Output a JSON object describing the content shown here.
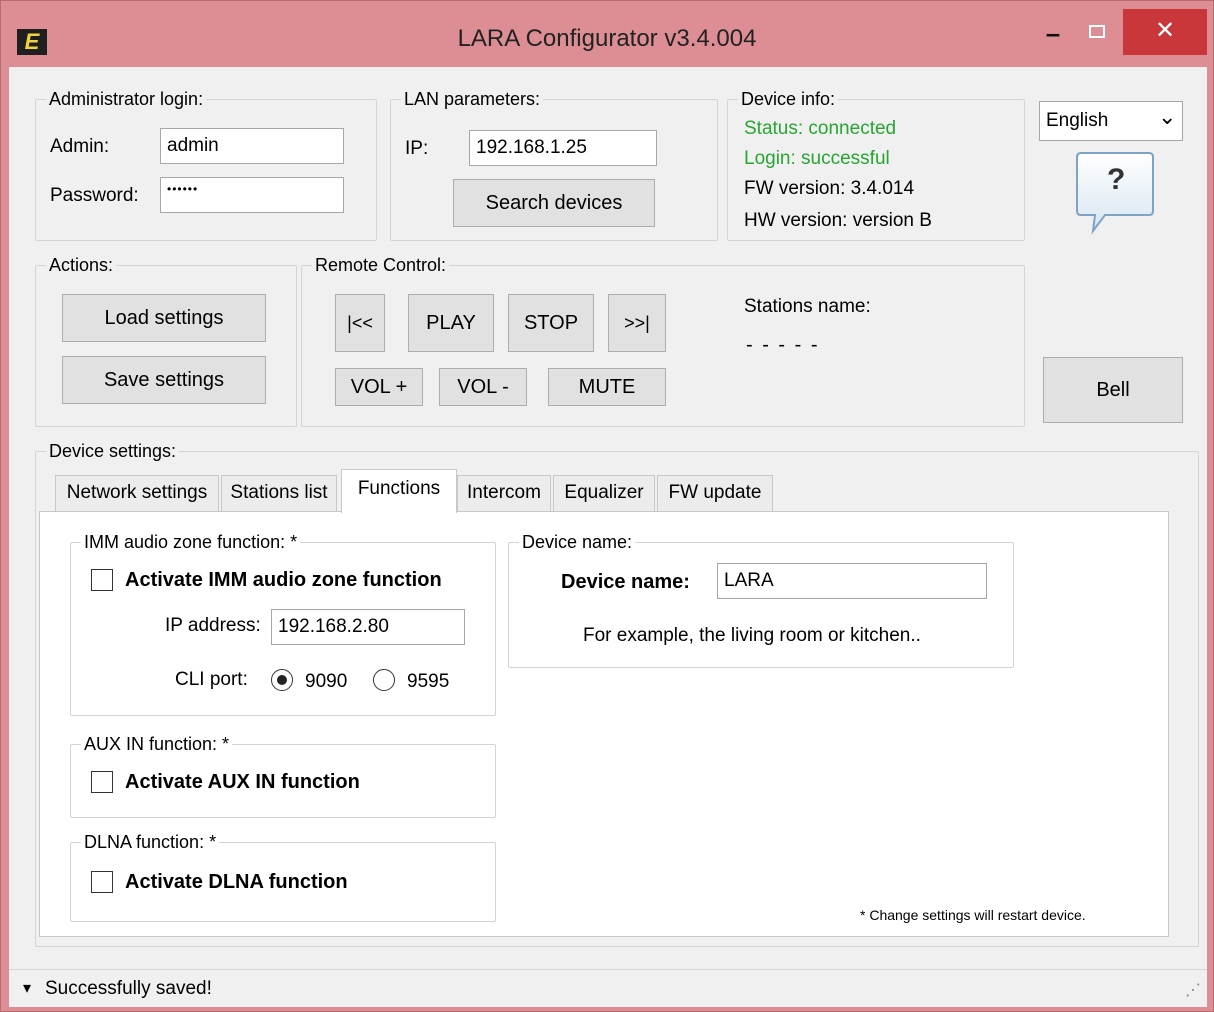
{
  "window": {
    "title": "LARA Configurator v3.4.004",
    "app_icon": "E",
    "minimize_glyph": "–",
    "close_glyph": "✕"
  },
  "admin_login": {
    "group_label": "Administrator login:",
    "admin_label": "Admin:",
    "admin_value": "admin",
    "password_label": "Password:",
    "password_value": "••••••"
  },
  "lan": {
    "group_label": "LAN parameters:",
    "ip_label": "IP:",
    "ip_value": "192.168.1.25",
    "search_button": "Search devices"
  },
  "device_info": {
    "group_label": "Device info:",
    "status": "Status: connected",
    "login": "Login: successful",
    "fw_version": "FW version: 3.4.014",
    "hw_version": "HW version: version B",
    "status_color": "#26a631"
  },
  "language": {
    "selected": "English",
    "chevron_glyph": "⌄"
  },
  "help": {
    "glyph": "?"
  },
  "actions": {
    "group_label": "Actions:",
    "load_button": "Load settings",
    "save_button": "Save settings"
  },
  "remote_control": {
    "group_label": "Remote Control:",
    "prev_button": "|<<",
    "play_button": "PLAY",
    "stop_button": "STOP",
    "next_button": ">>|",
    "vol_up_button": "VOL +",
    "vol_down_button": "VOL -",
    "mute_button": "MUTE",
    "stations_label": "Stations name:",
    "stations_value": "- - - - -"
  },
  "bell_button": "Bell",
  "device_settings": {
    "group_label": "Device settings:",
    "tabs": [
      "Network settings",
      "Stations list",
      "Functions",
      "Intercom",
      "Equalizer",
      "FW update"
    ],
    "active_tab": "Functions"
  },
  "functions": {
    "imm": {
      "group_label": "IMM audio zone function: *",
      "checkbox_label": "Activate IMM audio zone function",
      "checked": false,
      "ip_label": "IP address:",
      "ip_value": "192.168.2.80",
      "cli_label": "CLI port:",
      "port_options": [
        "9090",
        "9595"
      ],
      "selected_port": "9090"
    },
    "aux": {
      "group_label": "AUX IN function: *",
      "checkbox_label": "Activate AUX IN function",
      "checked": false
    },
    "dlna": {
      "group_label": "DLNA function: *",
      "checkbox_label": "Activate DLNA function",
      "checked": false
    },
    "device_name": {
      "group_label": "Device name:",
      "field_label": "Device name:",
      "value": "LARA",
      "hint": "For example, the living room or kitchen.."
    },
    "restart_note": "* Change settings will restart device."
  },
  "status_bar": {
    "message": "Successfully saved!",
    "arrow_glyph": "▾",
    "grip_glyph": "⋰"
  }
}
